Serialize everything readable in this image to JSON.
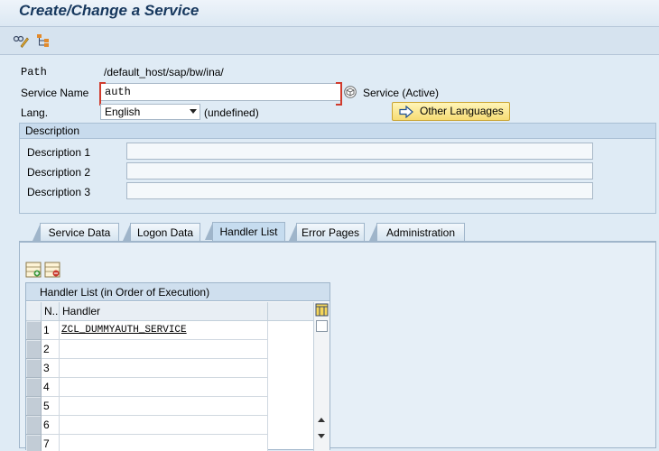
{
  "title": "Create/Change a Service",
  "toolbar": {
    "icons": [
      "display-change-icon",
      "hierarchy-icon"
    ]
  },
  "form": {
    "path_label": "Path",
    "path_value": "/default_host/sap/bw/ina/",
    "service_label": "Service Name",
    "service_value": "auth",
    "service_status": "Service (Active)",
    "lang_label": "Lang.",
    "lang_value": "English",
    "lang_note": "(undefined)",
    "other_languages": "Other Languages"
  },
  "description": {
    "header": "Description",
    "labels": [
      "Description 1",
      "Description 2",
      "Description 3"
    ],
    "values": [
      "",
      "",
      ""
    ]
  },
  "tabs": [
    "Service Data",
    "Logon Data",
    "Handler List",
    "Error Pages",
    "Administration"
  ],
  "active_tab": "Handler List",
  "handler_table": {
    "title": "Handler List (in Order of Execution)",
    "columns": [
      "N..",
      "Handler"
    ],
    "rows": [
      {
        "n": "1",
        "handler": "ZCL_DUMMYAUTH_SERVICE"
      },
      {
        "n": "2",
        "handler": ""
      },
      {
        "n": "3",
        "handler": ""
      },
      {
        "n": "4",
        "handler": ""
      },
      {
        "n": "5",
        "handler": ""
      },
      {
        "n": "6",
        "handler": ""
      },
      {
        "n": "7",
        "handler": ""
      }
    ]
  }
}
